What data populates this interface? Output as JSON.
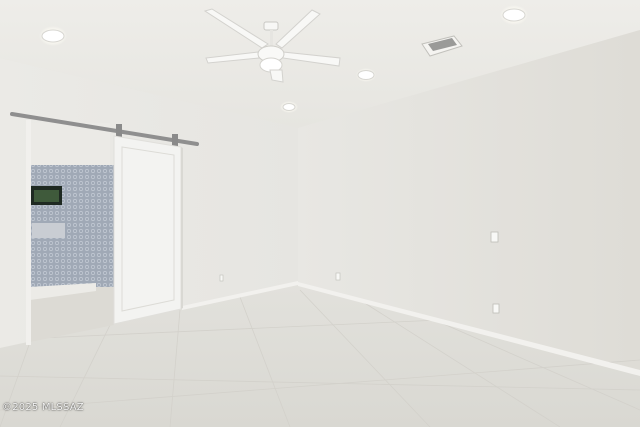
{
  "watermark": {
    "text": "©2025 MLSSAZ"
  },
  "colors": {
    "ceiling": "#ecebe7",
    "right_wall": "#e3e1dc",
    "left_wall": "#e9e8e4",
    "floor": "#e1dfda",
    "door": "#f3f3f1",
    "tile_wall": "#9ea7b4",
    "barn_rail": "#8f8f8f"
  },
  "icons": [
    "ceiling-fan-icon",
    "recessed-light-icon",
    "air-vent-icon",
    "light-switch-icon",
    "power-outlet-icon"
  ]
}
